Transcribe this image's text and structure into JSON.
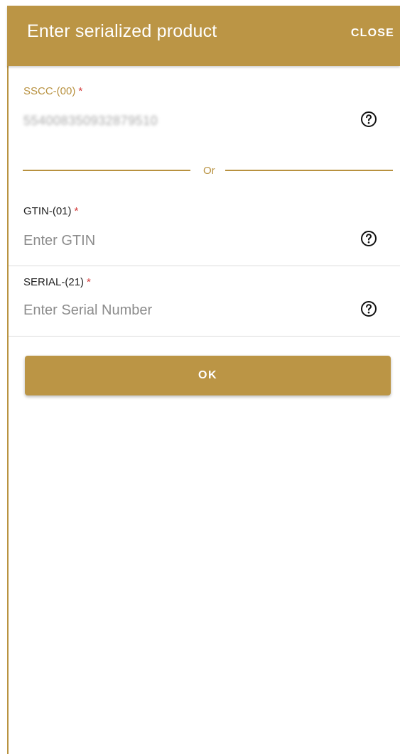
{
  "header": {
    "title": "Enter serialized product",
    "close_label": "CLOSE"
  },
  "sscc": {
    "label": "SSCC-(00)",
    "required_mark": "*",
    "value": "554008350932879510"
  },
  "divider": {
    "text": "Or"
  },
  "gtin": {
    "label": "GTIN-(01)",
    "required_mark": "*",
    "placeholder": "Enter GTIN"
  },
  "serial": {
    "label": "SERIAL-(21)",
    "required_mark": "*",
    "placeholder": "Enter Serial Number"
  },
  "ok_button": {
    "label": "OK"
  },
  "colors": {
    "accent": "#bb9545",
    "required": "#d33a3a"
  },
  "icons": {
    "help": "help-circle-icon"
  }
}
